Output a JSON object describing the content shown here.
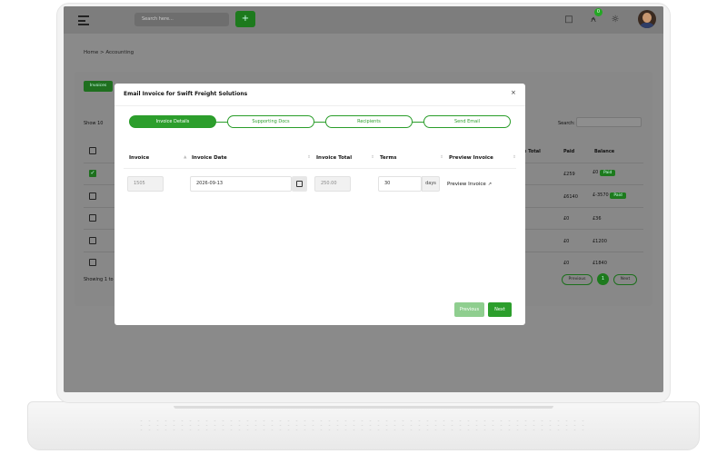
{
  "topbar": {
    "search_placeholder": "Search here...",
    "plus_label": "+",
    "notification_count": "0"
  },
  "breadcrumb": "Home > Accounting",
  "background": {
    "tab_label": "Invoices",
    "show_label": "Show",
    "show_value": "10",
    "search_label": "Search:",
    "col_total": "e Total",
    "col_paid": "Paid",
    "col_balance": "Balance",
    "showing_label": "Showing 1 to",
    "rows": [
      {
        "paid": "£259",
        "balance": "£0",
        "badge": "Paid"
      },
      {
        "paid": "£6140",
        "balance": "£-3570",
        "badge": "Paid"
      },
      {
        "paid": "£0",
        "balance": "£36",
        "badge": ""
      },
      {
        "paid": "£0",
        "balance": "£1200",
        "badge": ""
      },
      {
        "paid": "£0",
        "balance": "£1840",
        "badge": ""
      }
    ],
    "pagination": {
      "previous": "Previous",
      "current": "1",
      "next": "Next"
    }
  },
  "modal": {
    "title": "Email Invoice for Swift Freight Solutions",
    "close": "×",
    "steps": [
      "Invoice Details",
      "Supporting Docs",
      "Recipients",
      "Send Email"
    ],
    "active_step": 0,
    "columns": [
      "Invoice",
      "Invoice Date",
      "Invoice Total",
      "Terms",
      "Preview Invoice"
    ],
    "row": {
      "invoice": "1505",
      "invoice_date": "2026-09-13",
      "invoice_total": "250.00",
      "terms": "30",
      "terms_unit": "days",
      "preview_label": "Preview Invoice"
    },
    "buttons": {
      "previous": "Previous",
      "next": "Next"
    }
  },
  "colors": {
    "accent": "#2c9e2c",
    "overlay": "#8a8a8a"
  }
}
